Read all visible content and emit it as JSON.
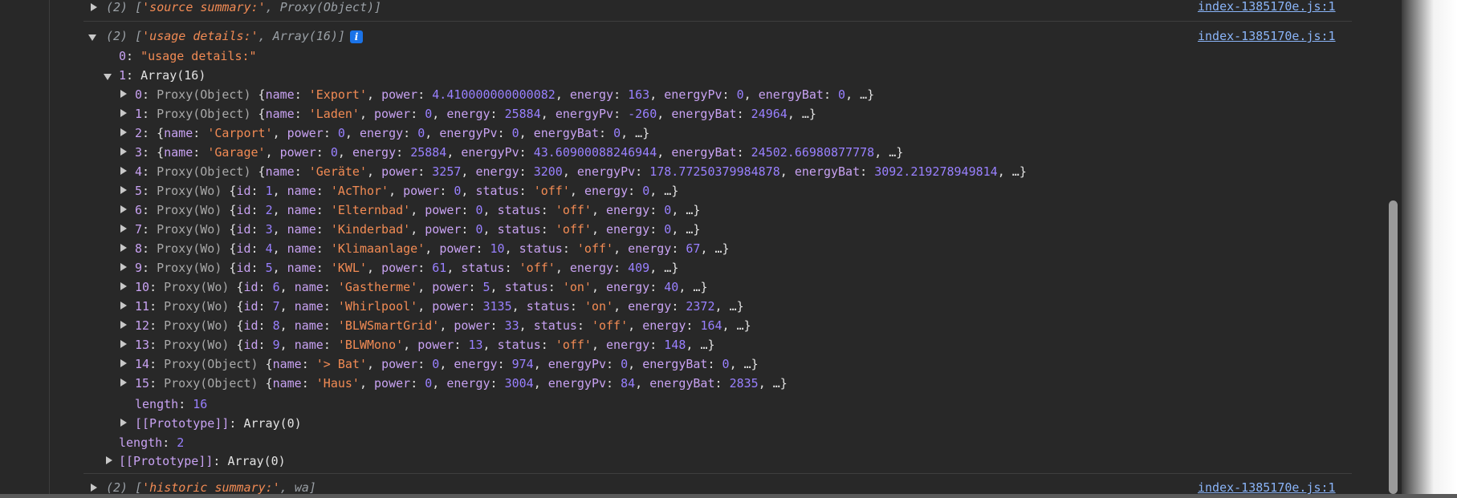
{
  "file_link": "index-1385170e.js:1",
  "log1": {
    "count": "(2)",
    "prefix": " [",
    "label": "'source summary:'",
    "sep": ", ",
    "value": "Proxy(Object)",
    "suffix": "]"
  },
  "log2": {
    "count": "(2)",
    "prefix": " [",
    "label": "'usage details:'",
    "sep": ", ",
    "value": "Array(16)",
    "suffix": "]",
    "info_icon": "i",
    "item0_key": "0",
    "item0_value": "\"usage details:\"",
    "item1_key": "1",
    "item1_value": "Array(16)",
    "length_key": "length",
    "length_value": "16",
    "proto_key": "[[Prototype]]",
    "proto_value": "Array(0)",
    "outer_length_key": "length",
    "outer_length_value": "2",
    "outer_proto_key": "[[Prototype]]",
    "outer_proto_value": "Array(0)"
  },
  "log3": {
    "count": "(2)",
    "prefix": " [",
    "label": "'historic summary:'",
    "sep": ", ",
    "value": "wa",
    "suffix": "]"
  },
  "entries": [
    {
      "index": "0",
      "type": "Proxy(Object)",
      "props": [
        [
          "name",
          "'Export'",
          "s"
        ],
        [
          "power",
          "4.410000000000082",
          "n"
        ],
        [
          "energy",
          "163",
          "n"
        ],
        [
          "energyPv",
          "0",
          "n"
        ],
        [
          "energyBat",
          "0",
          "n"
        ]
      ]
    },
    {
      "index": "1",
      "type": "Proxy(Object)",
      "props": [
        [
          "name",
          "'Laden'",
          "s"
        ],
        [
          "power",
          "0",
          "n"
        ],
        [
          "energy",
          "25884",
          "n"
        ],
        [
          "energyPv",
          "-260",
          "n"
        ],
        [
          "energyBat",
          "24964",
          "n"
        ]
      ]
    },
    {
      "index": "2",
      "type": "",
      "props": [
        [
          "name",
          "'Carport'",
          "s"
        ],
        [
          "power",
          "0",
          "n"
        ],
        [
          "energy",
          "0",
          "n"
        ],
        [
          "energyPv",
          "0",
          "n"
        ],
        [
          "energyBat",
          "0",
          "n"
        ]
      ]
    },
    {
      "index": "3",
      "type": "",
      "props": [
        [
          "name",
          "'Garage'",
          "s"
        ],
        [
          "power",
          "0",
          "n"
        ],
        [
          "energy",
          "25884",
          "n"
        ],
        [
          "energyPv",
          "43.60900088246944",
          "n"
        ],
        [
          "energyBat",
          "24502.66980877778",
          "n"
        ]
      ]
    },
    {
      "index": "4",
      "type": "Proxy(Object)",
      "props": [
        [
          "name",
          "'Geräte'",
          "s"
        ],
        [
          "power",
          "3257",
          "n"
        ],
        [
          "energy",
          "3200",
          "n"
        ],
        [
          "energyPv",
          "178.77250379984878",
          "n"
        ],
        [
          "energyBat",
          "3092.219278949814",
          "n"
        ]
      ]
    },
    {
      "index": "5",
      "type": "Proxy(Wo)",
      "props": [
        [
          "id",
          "1",
          "n"
        ],
        [
          "name",
          "'AcThor'",
          "s"
        ],
        [
          "power",
          "0",
          "n"
        ],
        [
          "status",
          "'off'",
          "s"
        ],
        [
          "energy",
          "0",
          "n"
        ]
      ]
    },
    {
      "index": "6",
      "type": "Proxy(Wo)",
      "props": [
        [
          "id",
          "2",
          "n"
        ],
        [
          "name",
          "'Elternbad'",
          "s"
        ],
        [
          "power",
          "0",
          "n"
        ],
        [
          "status",
          "'off'",
          "s"
        ],
        [
          "energy",
          "0",
          "n"
        ]
      ]
    },
    {
      "index": "7",
      "type": "Proxy(Wo)",
      "props": [
        [
          "id",
          "3",
          "n"
        ],
        [
          "name",
          "'Kinderbad'",
          "s"
        ],
        [
          "power",
          "0",
          "n"
        ],
        [
          "status",
          "'off'",
          "s"
        ],
        [
          "energy",
          "0",
          "n"
        ]
      ]
    },
    {
      "index": "8",
      "type": "Proxy(Wo)",
      "props": [
        [
          "id",
          "4",
          "n"
        ],
        [
          "name",
          "'Klimaanlage'",
          "s"
        ],
        [
          "power",
          "10",
          "n"
        ],
        [
          "status",
          "'off'",
          "s"
        ],
        [
          "energy",
          "67",
          "n"
        ]
      ]
    },
    {
      "index": "9",
      "type": "Proxy(Wo)",
      "props": [
        [
          "id",
          "5",
          "n"
        ],
        [
          "name",
          "'KWL'",
          "s"
        ],
        [
          "power",
          "61",
          "n"
        ],
        [
          "status",
          "'off'",
          "s"
        ],
        [
          "energy",
          "409",
          "n"
        ]
      ]
    },
    {
      "index": "10",
      "type": "Proxy(Wo)",
      "props": [
        [
          "id",
          "6",
          "n"
        ],
        [
          "name",
          "'Gastherme'",
          "s"
        ],
        [
          "power",
          "5",
          "n"
        ],
        [
          "status",
          "'on'",
          "s"
        ],
        [
          "energy",
          "40",
          "n"
        ]
      ]
    },
    {
      "index": "11",
      "type": "Proxy(Wo)",
      "props": [
        [
          "id",
          "7",
          "n"
        ],
        [
          "name",
          "'Whirlpool'",
          "s"
        ],
        [
          "power",
          "3135",
          "n"
        ],
        [
          "status",
          "'on'",
          "s"
        ],
        [
          "energy",
          "2372",
          "n"
        ]
      ]
    },
    {
      "index": "12",
      "type": "Proxy(Wo)",
      "props": [
        [
          "id",
          "8",
          "n"
        ],
        [
          "name",
          "'BLWSmartGrid'",
          "s"
        ],
        [
          "power",
          "33",
          "n"
        ],
        [
          "status",
          "'off'",
          "s"
        ],
        [
          "energy",
          "164",
          "n"
        ]
      ]
    },
    {
      "index": "13",
      "type": "Proxy(Wo)",
      "props": [
        [
          "id",
          "9",
          "n"
        ],
        [
          "name",
          "'BLWMono'",
          "s"
        ],
        [
          "power",
          "13",
          "n"
        ],
        [
          "status",
          "'off'",
          "s"
        ],
        [
          "energy",
          "148",
          "n"
        ]
      ]
    },
    {
      "index": "14",
      "type": "Proxy(Object)",
      "props": [
        [
          "name",
          "'> Bat'",
          "s"
        ],
        [
          "power",
          "0",
          "n"
        ],
        [
          "energy",
          "974",
          "n"
        ],
        [
          "energyPv",
          "0",
          "n"
        ],
        [
          "energyBat",
          "0",
          "n"
        ]
      ]
    },
    {
      "index": "15",
      "type": "Proxy(Object)",
      "props": [
        [
          "name",
          "'Haus'",
          "s"
        ],
        [
          "power",
          "0",
          "n"
        ],
        [
          "energy",
          "3004",
          "n"
        ],
        [
          "energyPv",
          "84",
          "n"
        ],
        [
          "energyBat",
          "2835",
          "n"
        ]
      ]
    }
  ],
  "ellipsis": "…"
}
